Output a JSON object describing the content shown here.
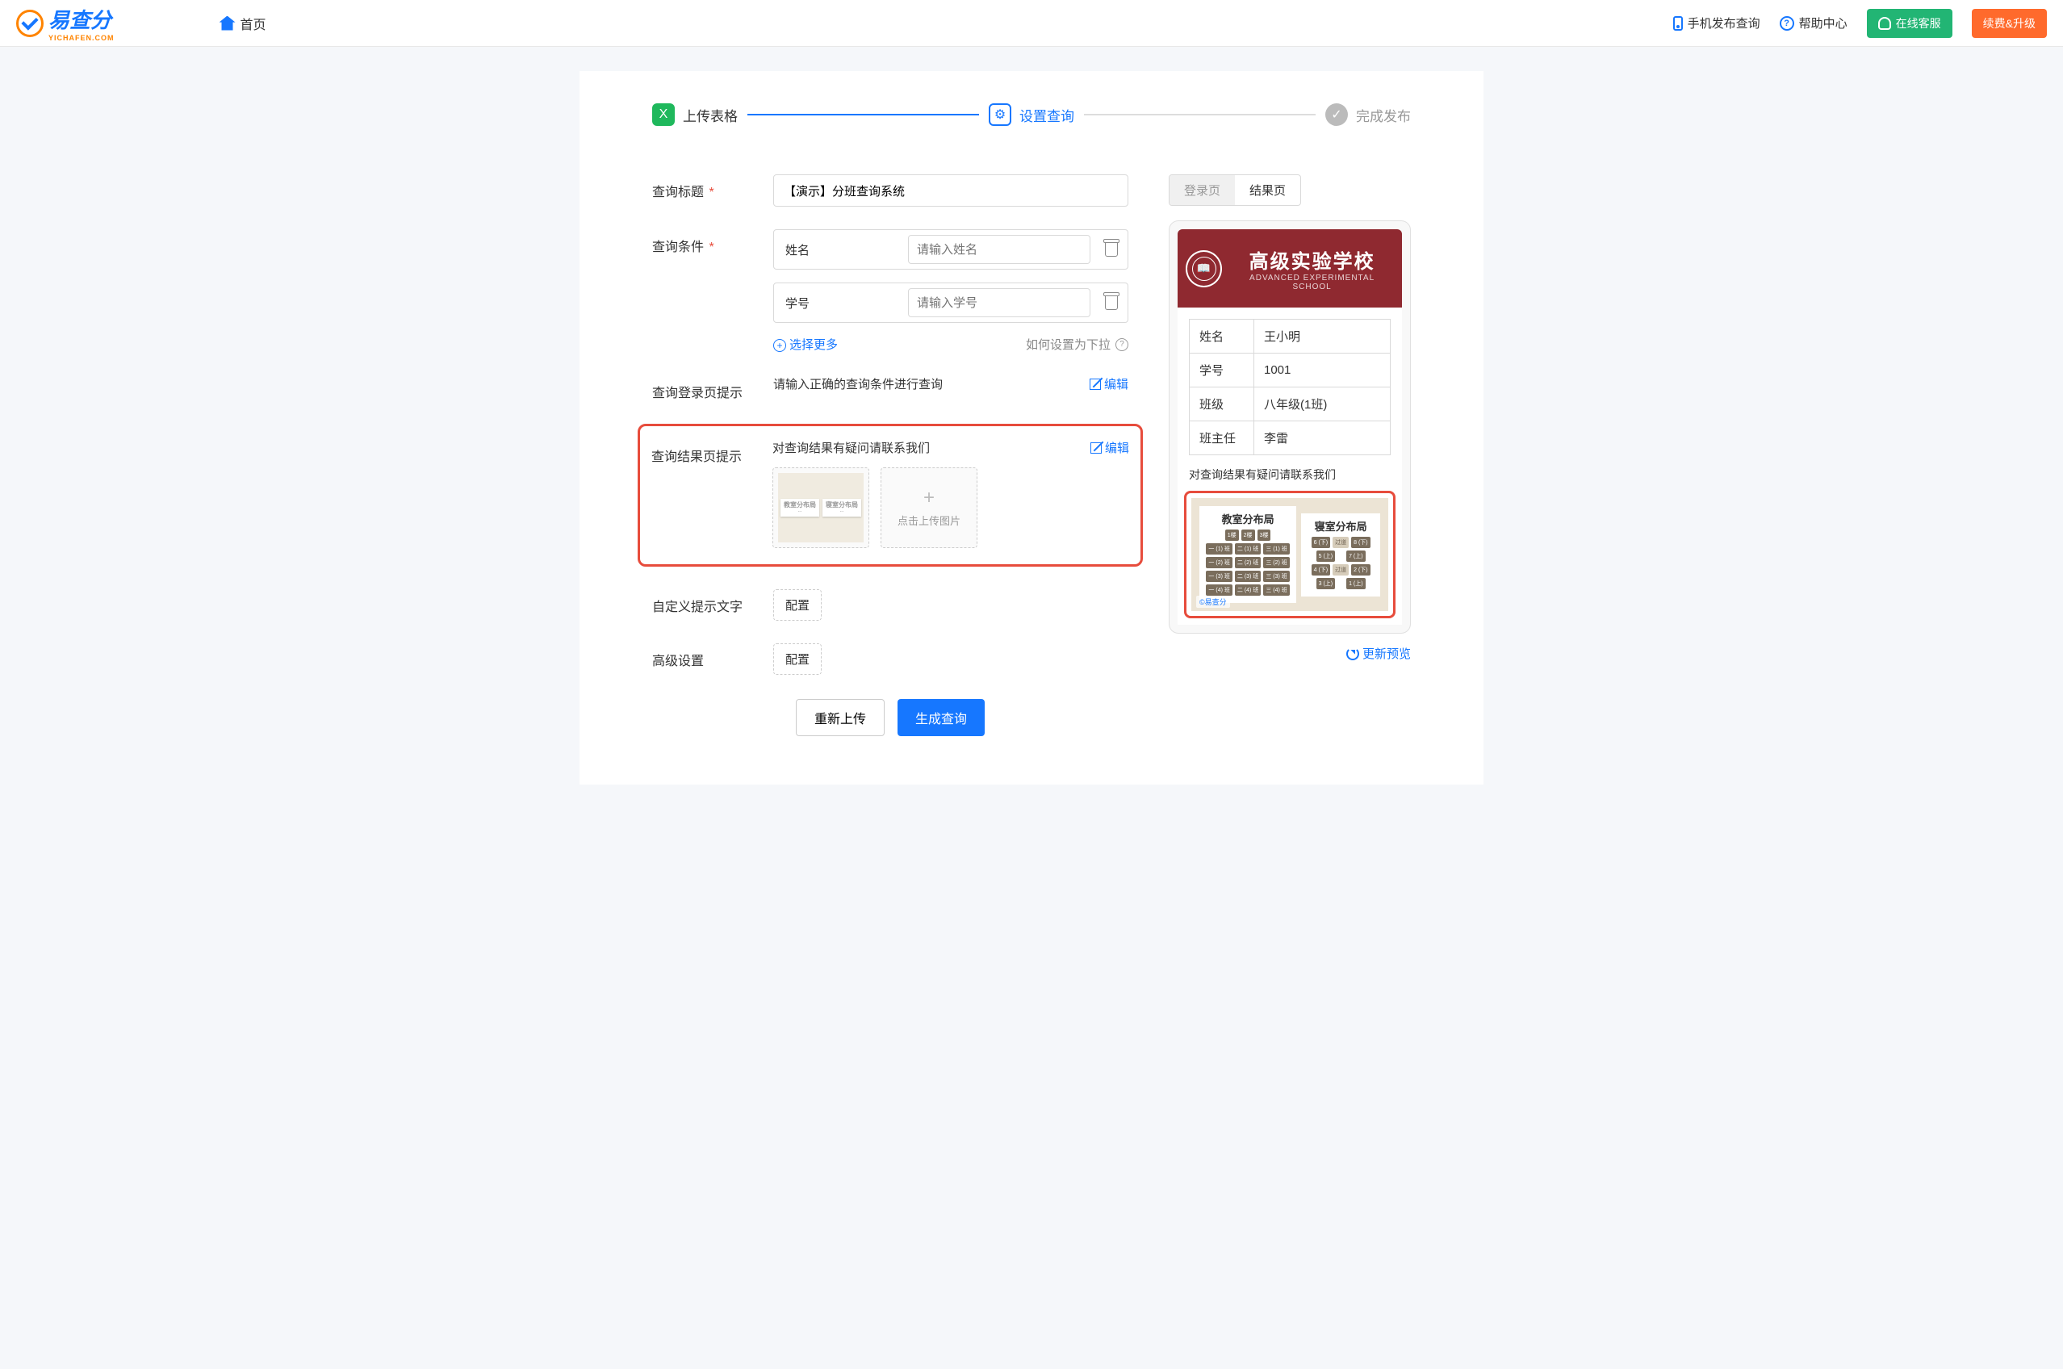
{
  "header": {
    "logo_text": "易查分",
    "logo_sub": "YICHAFEN.COM",
    "home": "首页",
    "mobile_publish": "手机发布查询",
    "help_center": "帮助中心",
    "online_service": "在线客服",
    "renew": "续费&升级"
  },
  "steps": {
    "s1": "上传表格",
    "s2": "设置查询",
    "s3": "完成发布"
  },
  "form": {
    "title_label": "查询标题",
    "title_value": "【演示】分班查询系统",
    "cond_label": "查询条件",
    "cond1_name": "姓名",
    "cond1_ph": "请输入姓名",
    "cond2_name": "学号",
    "cond2_ph": "请输入学号",
    "select_more": "选择更多",
    "howto_dropdown": "如何设置为下拉",
    "login_hint_label": "查询登录页提示",
    "login_hint_text": "请输入正确的查询条件进行查询",
    "edit": "编辑",
    "result_hint_label": "查询结果页提示",
    "result_hint_text": "对查询结果有疑问请联系我们",
    "upload_img": "点击上传图片",
    "custom_text_label": "自定义提示文字",
    "configure": "配置",
    "advanced_label": "高级设置",
    "reupload": "重新上传",
    "generate": "生成查询"
  },
  "preview": {
    "tab_login": "登录页",
    "tab_result": "结果页",
    "school_name": "高级实验学校",
    "school_en": "ADVANCED EXPERIMENTAL SCHOOL",
    "rows": [
      {
        "k": "姓名",
        "v": "王小明"
      },
      {
        "k": "学号",
        "v": "1001"
      },
      {
        "k": "班级",
        "v": "八年级(1班)"
      },
      {
        "k": "班主任",
        "v": "李雷"
      }
    ],
    "result_hint": "对查询结果有疑问请联系我们",
    "board1_title": "教室分布局",
    "board2_title": "寝室分布局",
    "divider": "过道",
    "floor1": "1楼",
    "floor2": "2楼",
    "floor3": "3楼",
    "cells": {
      "r1c1": "一 (1) 班",
      "r1c2": "二 (1) 班",
      "r1c3": "三 (1) 班",
      "r2c1": "一 (2) 班",
      "r2c2": "二 (2) 班",
      "r2c3": "三 (2) 班",
      "r3c1": "一 (3) 班",
      "r3c2": "二 (3) 班",
      "r3c3": "三 (3) 班",
      "r4c1": "一 (4) 班",
      "r4c2": "二 (4) 班",
      "r4c3": "三 (4) 班"
    },
    "dorm": {
      "a1": "6 (下)",
      "a2": "8 (下)",
      "b1": "5 (上)",
      "b2": "7 (上)",
      "c1": "4 (下)",
      "c2": "2 (下)",
      "d1": "3 (上)",
      "d2": "1 (上)"
    },
    "wm": "©易查分",
    "refresh": "更新预览"
  }
}
